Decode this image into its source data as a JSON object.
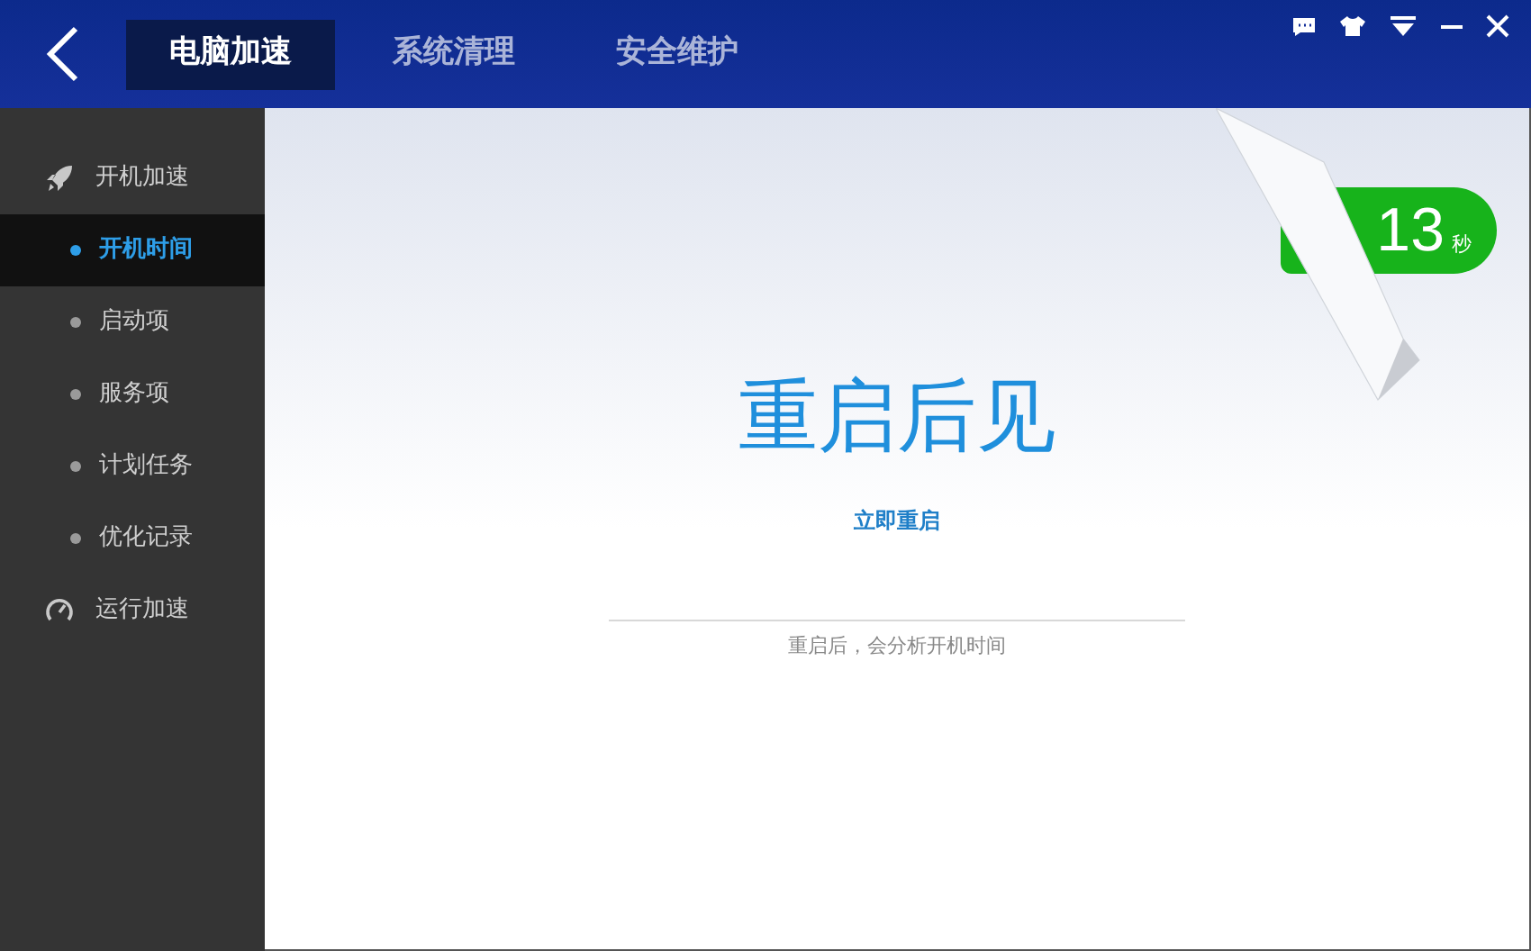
{
  "tabs": [
    {
      "label": "电脑加速",
      "selected": true
    },
    {
      "label": "系统清理",
      "selected": false
    },
    {
      "label": "安全维护",
      "selected": false
    }
  ],
  "sidebar": {
    "items": [
      {
        "label": "开机加速",
        "kind": "rocket",
        "children": [
          {
            "label": "开机时间",
            "selected": true
          },
          {
            "label": "启动项",
            "selected": false
          },
          {
            "label": "服务项",
            "selected": false
          },
          {
            "label": "计划任务",
            "selected": false
          },
          {
            "label": "优化记录",
            "selected": false
          }
        ]
      },
      {
        "label": "运行加速",
        "kind": "gauge"
      }
    ]
  },
  "badge": {
    "value": "13",
    "unit": "秒"
  },
  "main": {
    "title": "重启后见",
    "action": "立即重启",
    "note": "重启后，会分析开机时间"
  }
}
